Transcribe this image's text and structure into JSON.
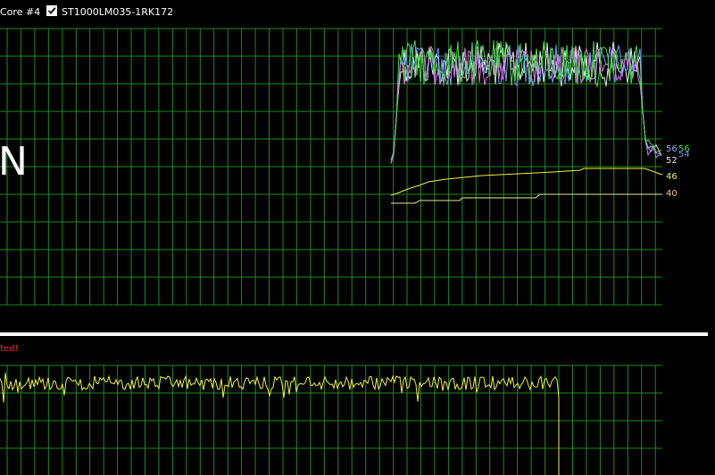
{
  "toolbar": {
    "core_label": "Core #4",
    "drive_checked": true,
    "drive_label": "ST1000LM035-1RK172"
  },
  "overlay": {
    "big_letter": "N",
    "status_text": "ted!"
  },
  "series_labels": [
    {
      "text": "56",
      "color": "#8fb0ff"
    },
    {
      "text": "56",
      "color": "#40e040"
    },
    {
      "text": "54",
      "color": "#5aa0ff"
    },
    {
      "text": "52",
      "color": "#e8e8e8"
    },
    {
      "text": "46",
      "color": "#f0f060"
    },
    {
      "text": "40",
      "color": "#f0d070"
    }
  ],
  "colors": {
    "grid": "#1a8c1a",
    "background": "#000000",
    "green_series": "#40e040",
    "pink_series": "#e070e0",
    "blue_series": "#70a0ff",
    "white_series": "#e8e8e8",
    "yellow_series": "#f0f040"
  },
  "icons": [
    "checkbox-checked-icon"
  ]
}
